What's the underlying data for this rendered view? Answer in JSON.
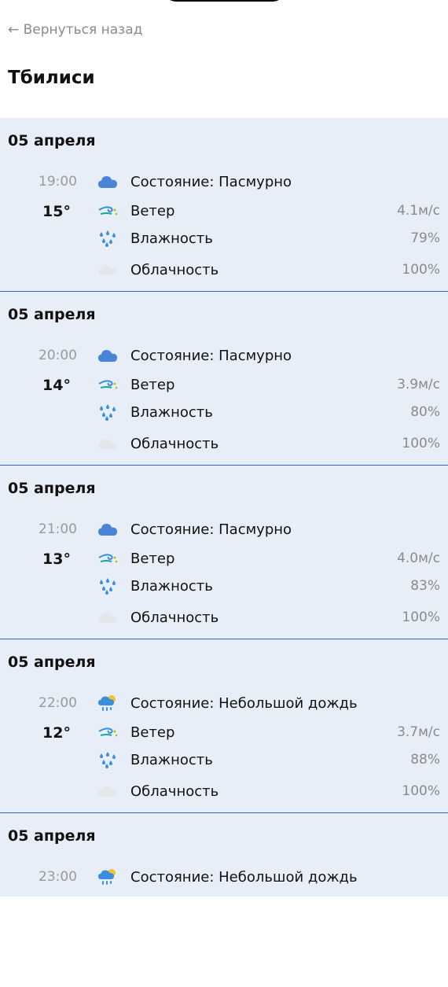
{
  "nav": {
    "back_label": "← Вернуться назад"
  },
  "city": "Тбилиси",
  "labels": {
    "state_prefix": "Состояние: ",
    "wind": "Ветер",
    "humidity": "Влажность",
    "cloudiness": "Облачность"
  },
  "colors": {
    "panel_bg": "#e8eef7",
    "divider": "#3a5fd0",
    "muted": "#8a8a8a"
  },
  "forecasts": [
    {
      "date": "05 апреля",
      "time": "19:00",
      "temp": "15°",
      "state": "Состояние: Пасмурно",
      "state_icon": "cloud-icon",
      "wind": "4.1м/с",
      "humidity": "79%",
      "clouds": "100%"
    },
    {
      "date": "05 апреля",
      "time": "20:00",
      "temp": "14°",
      "state": "Состояние: Пасмурно",
      "state_icon": "cloud-icon",
      "wind": "3.9м/с",
      "humidity": "80%",
      "clouds": "100%"
    },
    {
      "date": "05 апреля",
      "time": "21:00",
      "temp": "13°",
      "state": "Состояние: Пасмурно",
      "state_icon": "cloud-icon",
      "wind": "4.0м/с",
      "humidity": "83%",
      "clouds": "100%"
    },
    {
      "date": "05 апреля",
      "time": "22:00",
      "temp": "12°",
      "state": "Состояние: Небольшой дождь",
      "state_icon": "light-rain-icon",
      "wind": "3.7м/с",
      "humidity": "88%",
      "clouds": "100%"
    },
    {
      "date": "05 апреля",
      "time": "23:00",
      "temp": "",
      "state": "Состояние: Небольшой дождь",
      "state_icon": "light-rain-icon",
      "wind": "",
      "humidity": "",
      "clouds": ""
    }
  ]
}
